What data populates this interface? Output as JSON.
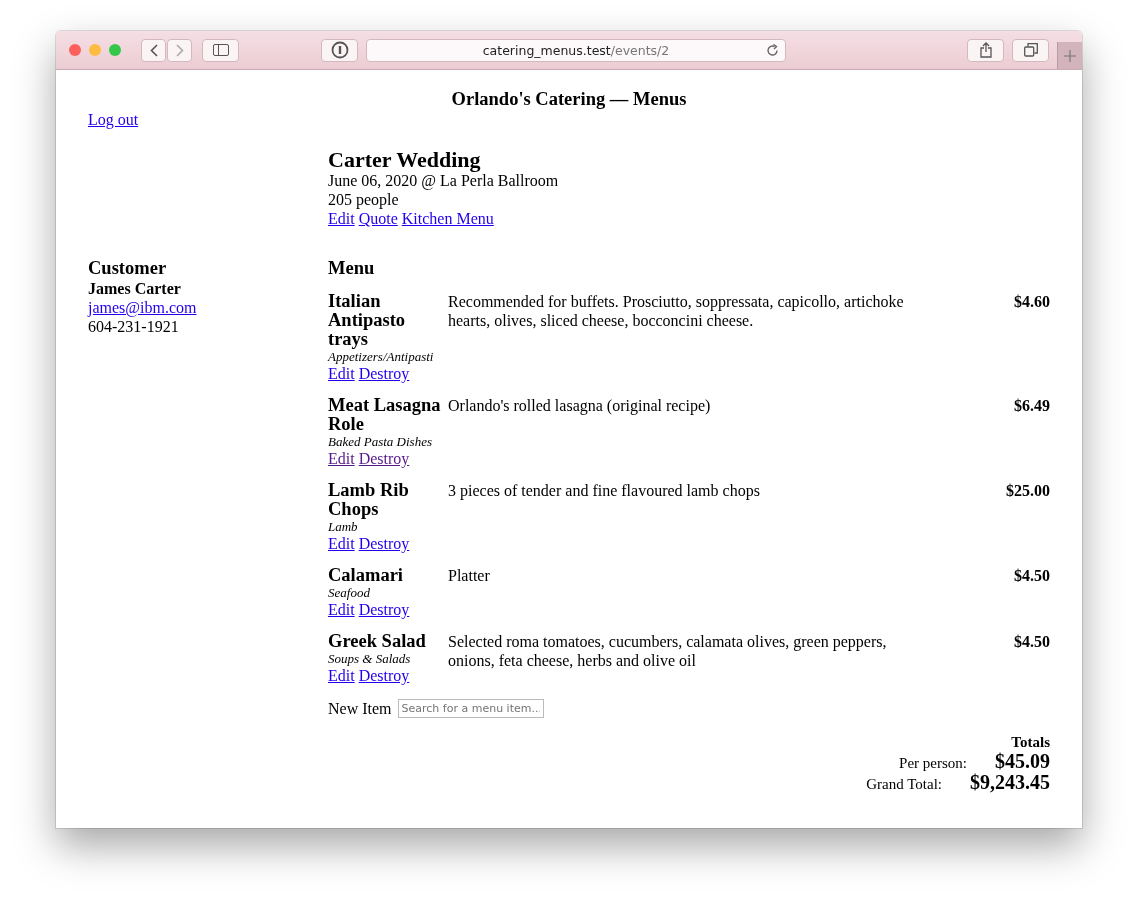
{
  "browser": {
    "url_host": "catering_menus.test",
    "url_path": "/events/2"
  },
  "header": {
    "title": "Orlando's Catering — Menus",
    "logout": "Log out"
  },
  "event": {
    "title": "Carter Wedding",
    "date_venue": "June 06, 2020 @ La Perla Ballroom",
    "guests": "205 people",
    "links": [
      "Edit",
      "Quote",
      "Kitchen Menu"
    ]
  },
  "customer": {
    "heading": "Customer",
    "name": "James Carter",
    "email": "james@ibm.com",
    "phone": "604-231-1921"
  },
  "menu": {
    "heading": "Menu",
    "items": [
      {
        "name": "Italian Antipasto trays",
        "category": "Appetizers/Antipasti",
        "description": "Recommended for buffets. Prosciutto, soppressata, capicollo, artichoke hearts, olives, sliced cheese, bocconcini cheese.",
        "price": "$4.60",
        "links": [
          {
            "label": "Edit",
            "visited": false
          },
          {
            "label": "Destroy",
            "visited": false
          }
        ]
      },
      {
        "name": "Meat Lasagna Role",
        "category": "Baked Pasta Dishes",
        "description": "Orlando's rolled lasagna (original recipe)",
        "price": "$6.49",
        "links": [
          {
            "label": "Edit",
            "visited": true
          },
          {
            "label": "Destroy",
            "visited": true
          }
        ]
      },
      {
        "name": "Lamb Rib Chops",
        "category": "Lamb",
        "description": "3 pieces of tender and fine flavoured lamb chops",
        "price": "$25.00",
        "links": [
          {
            "label": "Edit",
            "visited": false
          },
          {
            "label": "Destroy",
            "visited": false
          }
        ]
      },
      {
        "name": "Calamari",
        "category": "Seafood",
        "description": "Platter",
        "price": "$4.50",
        "links": [
          {
            "label": "Edit",
            "visited": false
          },
          {
            "label": "Destroy",
            "visited": false
          }
        ]
      },
      {
        "name": "Greek Salad",
        "category": "Soups & Salads",
        "description": "Selected roma tomatoes, cucumbers, calamata olives, green peppers, onions, feta cheese, herbs and olive oil",
        "price": "$4.50",
        "links": [
          {
            "label": "Edit",
            "visited": false
          },
          {
            "label": "Destroy",
            "visited": false
          }
        ]
      }
    ],
    "new_item": {
      "label": "New Item",
      "placeholder": "Search for a menu item..."
    }
  },
  "totals": {
    "heading": "Totals",
    "rows": [
      {
        "label": "Per person:",
        "value": "$45.09"
      },
      {
        "label": "Grand Total:",
        "value": "$9,243.45"
      }
    ]
  }
}
